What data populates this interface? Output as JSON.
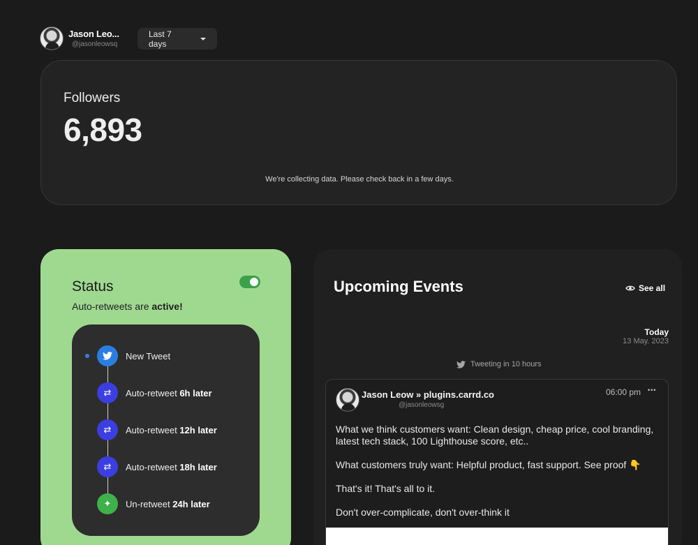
{
  "header": {
    "user_name": "Jason Leo...",
    "user_handle": "@jasonleowsq",
    "range_label": "Last 7 days"
  },
  "followers": {
    "label": "Followers",
    "value": "6,893",
    "note": "We're collecting data. Please check back in a few days."
  },
  "status": {
    "title": "Status",
    "subtitle_prefix": "Auto-retweets are ",
    "subtitle_state": "active!",
    "toggle_on": true,
    "steps": [
      {
        "icon": "twitter-icon",
        "text": "New Tweet",
        "bold": "",
        "color": "#2c7de3"
      },
      {
        "icon": "retweet-icon",
        "text": "Auto-retweet ",
        "bold": "6h later",
        "color": "#3b3ee0"
      },
      {
        "icon": "retweet-icon",
        "text": "Auto-retweet ",
        "bold": "12h later",
        "color": "#3b3ee0"
      },
      {
        "icon": "retweet-icon",
        "text": "Auto-retweet ",
        "bold": "18h later",
        "color": "#3b3ee0"
      },
      {
        "icon": "sparkle-icon",
        "text": "Un-retweet ",
        "bold": "24h later",
        "color": "#3fb14a"
      }
    ]
  },
  "events": {
    "title": "Upcoming Events",
    "see_all": "See all",
    "day_label": "Today",
    "day_date": "13 May. 2023",
    "tweeting_note": "Tweeting in 10 hours",
    "tweet": {
      "author": "Jason Leow » plugins.carrd.co",
      "handle": "@jasonleowsg",
      "time": "06:00 pm",
      "more": "•••",
      "paragraphs": [
        "What we think customers want: Clean design, cheap price, cool branding, latest tech stack, 100 Lighthouse score, etc..",
        "What customers truly want: Helpful product, fast support. See proof 👇",
        "That's it! That's all to it.",
        "Don't over-complicate, don't over-think it"
      ]
    }
  }
}
